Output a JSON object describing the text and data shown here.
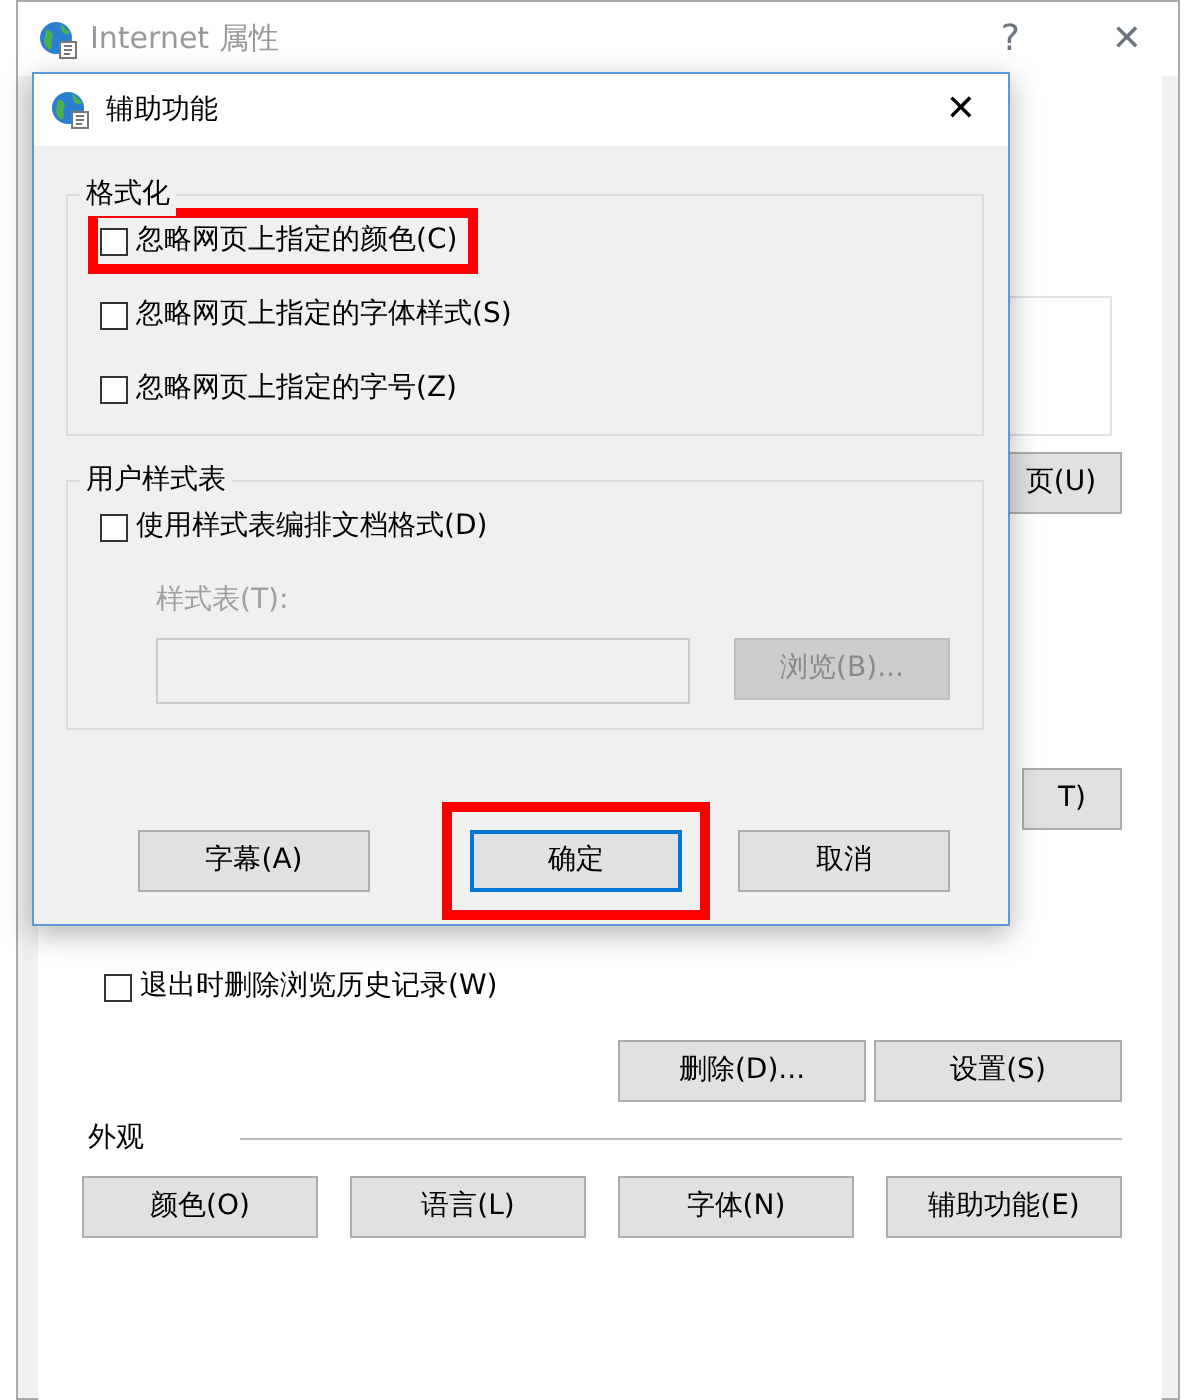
{
  "back_window": {
    "title": "Internet 属性",
    "help": "?",
    "close": "✕",
    "partial_button_top": "页(U)",
    "partial_button_mid": "T)",
    "exit_checkbox": {
      "label": "退出时删除浏览历史记录(W)",
      "checked": false
    },
    "history_buttons": [
      "删除(D)...",
      "设置(S)"
    ],
    "appearance": {
      "title": "外观",
      "buttons": [
        "颜色(O)",
        "语言(L)",
        "字体(N)",
        "辅助功能(E)"
      ]
    }
  },
  "dialog": {
    "title": "辅助功能",
    "close": "✕",
    "groups": [
      {
        "title": "格式化",
        "items": [
          {
            "kind": "checkbox",
            "label": "忽略网页上指定的颜色(C)",
            "checked": false,
            "highlighted": true
          },
          {
            "kind": "checkbox",
            "label": "忽略网页上指定的字体样式(S)",
            "checked": false,
            "highlighted": false
          },
          {
            "kind": "checkbox",
            "label": "忽略网页上指定的字号(Z)",
            "checked": false,
            "highlighted": false
          }
        ]
      },
      {
        "title": "用户样式表",
        "items": [
          {
            "kind": "checkbox",
            "label": "使用样式表编排文档格式(D)",
            "checked": false,
            "highlighted": false
          },
          {
            "kind": "file",
            "label": "样式表(T):",
            "button": "浏览(B)...",
            "disabled": true
          }
        ]
      }
    ],
    "buttons": [
      {
        "label": "字幕(A)",
        "default": false,
        "highlighted": false
      },
      {
        "label": "确定",
        "default": true,
        "highlighted": true
      },
      {
        "label": "取消",
        "default": false,
        "highlighted": false
      }
    ]
  }
}
